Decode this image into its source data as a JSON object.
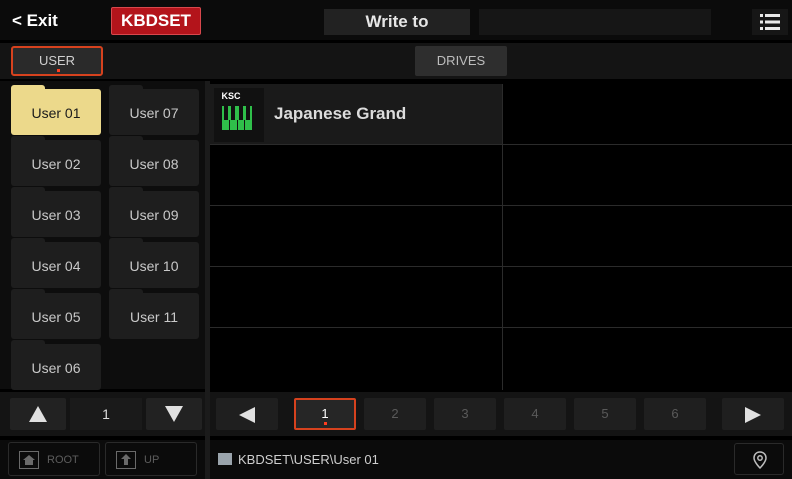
{
  "topbar": {
    "exit_label": "< Exit",
    "mode_label": "KBDSET",
    "write_to_label": "Write to",
    "menu_icon": "hamburger-list-icon"
  },
  "subbar": {
    "user_tab": "USER",
    "drives_tab": "DRIVES"
  },
  "folders": [
    {
      "label": "User 01",
      "selected": true
    },
    {
      "label": "User 02"
    },
    {
      "label": "User 03"
    },
    {
      "label": "User 04"
    },
    {
      "label": "User 05"
    },
    {
      "label": "User 06"
    },
    {
      "label": "User 07"
    },
    {
      "label": "User 08"
    },
    {
      "label": "User 09"
    },
    {
      "label": "User 10"
    },
    {
      "label": "User 11"
    }
  ],
  "left_pager": {
    "page": "1",
    "up_icon": "triangle-up-icon",
    "down_icon": "triangle-down-icon"
  },
  "files": [
    {
      "type_label": "KSC",
      "name": "Japanese Grand",
      "icon": "piano-keys-icon"
    }
  ],
  "right_pager": {
    "pages": [
      "1",
      "2",
      "3",
      "4",
      "5",
      "6"
    ],
    "current": "1"
  },
  "bottombar": {
    "root_label": "ROOT",
    "up_label": "UP",
    "path": "KBDSET\\USER\\User 01",
    "location_icon": "location-pin-icon"
  },
  "colors": {
    "accent_red": "#b3141b",
    "selection_outline": "#d6421e",
    "selected_folder": "#ecd98b",
    "piano_green": "#2fbf4a"
  }
}
